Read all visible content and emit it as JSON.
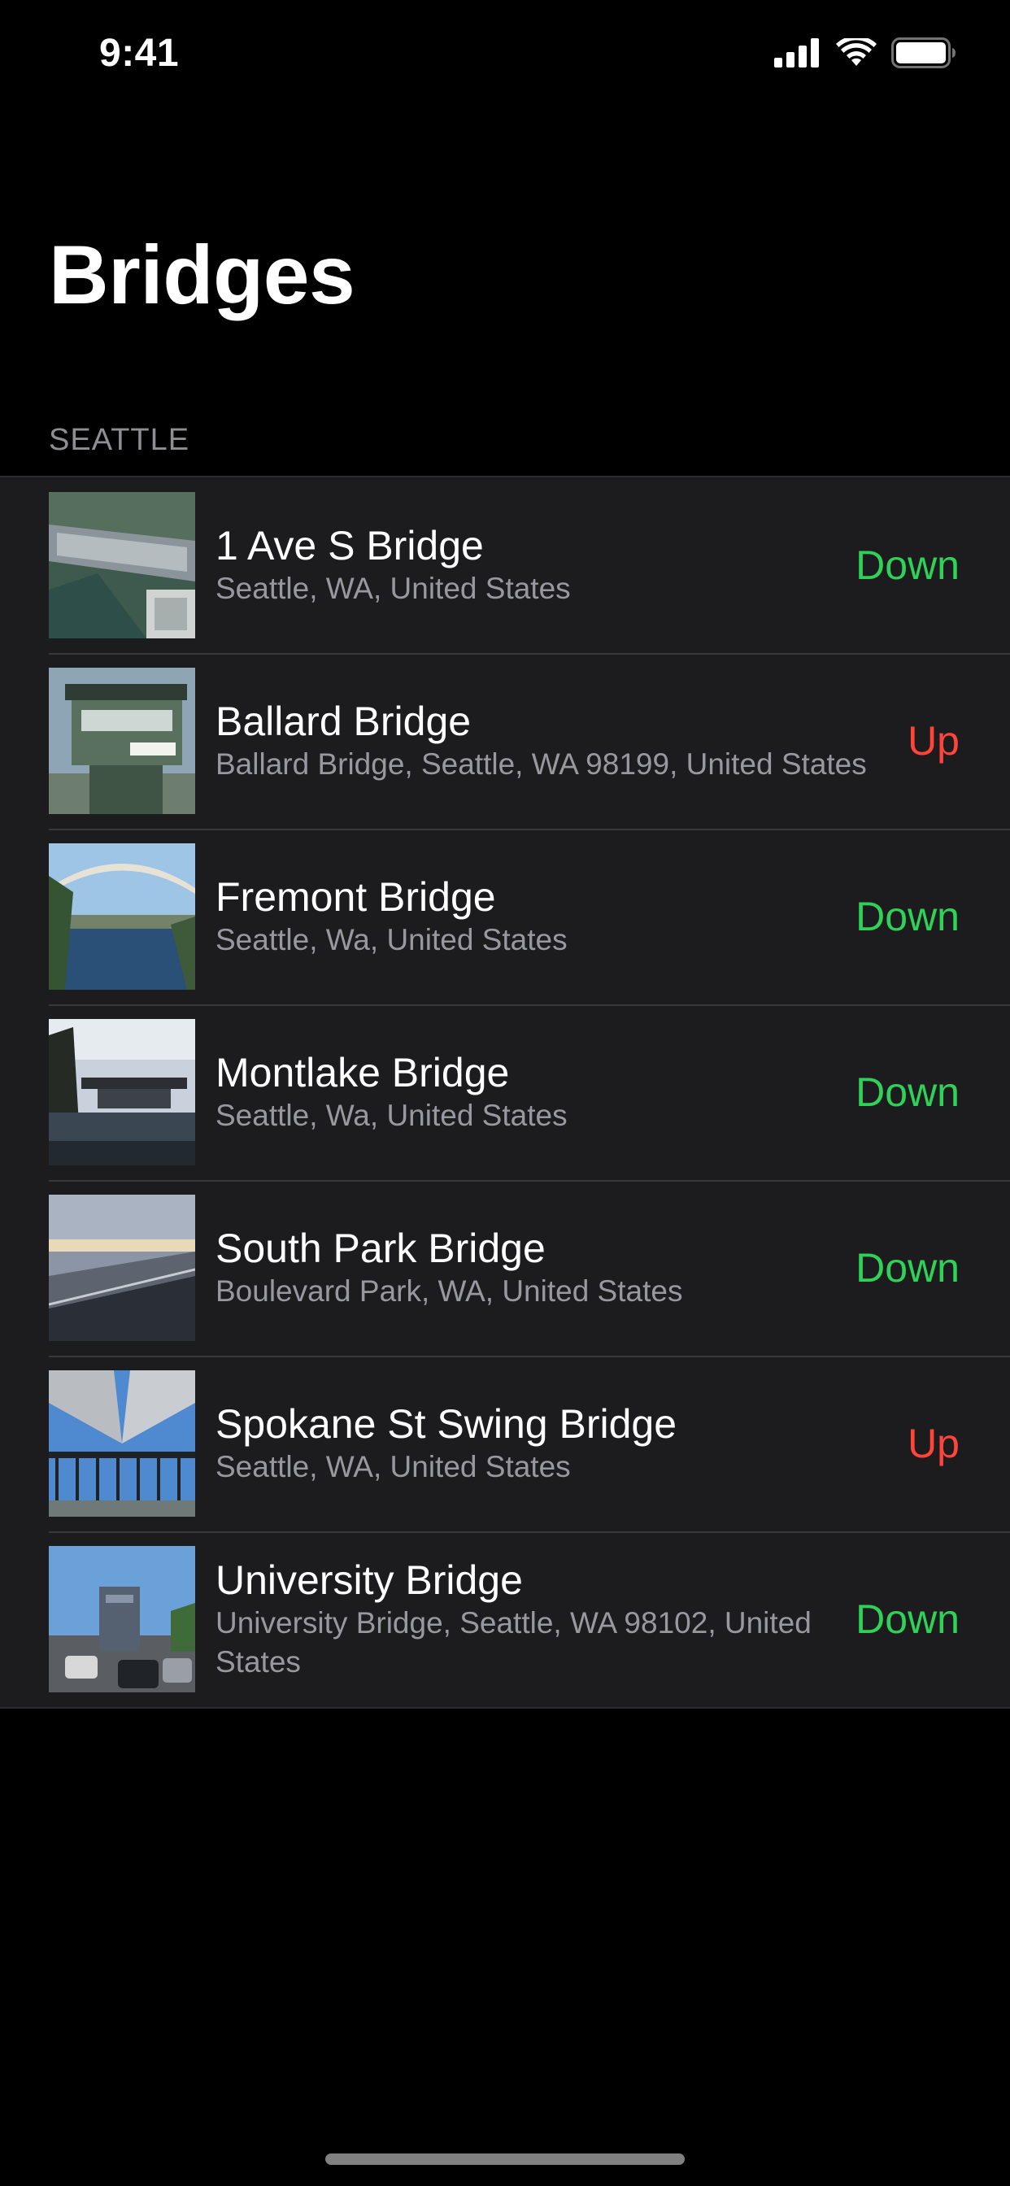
{
  "status_bar": {
    "time": "9:41"
  },
  "nav": {
    "title": "Bridges"
  },
  "section": {
    "header": "SEATTLE"
  },
  "bridges": [
    {
      "name": "1 Ave S Bridge",
      "location": "Seattle, WA, United States",
      "status": "Down",
      "thumb": "aerial-bridge-photo"
    },
    {
      "name": "Ballard Bridge",
      "location": "Ballard Bridge, Seattle, WA 98199, United States",
      "status": "Up",
      "thumb": "bridge-tower-photo"
    },
    {
      "name": "Fremont Bridge",
      "location": "Seattle, Wa, United States",
      "status": "Down",
      "thumb": "arch-bridge-photo"
    },
    {
      "name": "Montlake Bridge",
      "location": "Seattle, Wa, United States",
      "status": "Down",
      "thumb": "bascule-bridge-photo"
    },
    {
      "name": "South Park Bridge",
      "location": "Boulevard Park, WA, United States",
      "status": "Down",
      "thumb": "roadway-bridge-photo"
    },
    {
      "name": "Spokane St Swing Bridge",
      "location": "Seattle, WA, United States",
      "status": "Up",
      "thumb": "overpass-bridge-photo"
    },
    {
      "name": "University Bridge",
      "location": "University Bridge, Seattle, WA  98102, United States",
      "status": "Down",
      "thumb": "traffic-bridge-photo"
    }
  ],
  "colors": {
    "down": "#30d158",
    "up": "#ff453a",
    "background": "#000000",
    "cell": "#1c1c1e"
  }
}
